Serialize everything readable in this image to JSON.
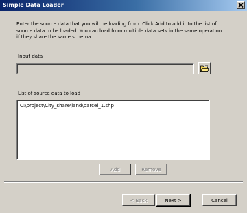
{
  "window": {
    "title": "Simple Data Loader",
    "close_icon": "close-icon"
  },
  "instructions": "Enter the source data that you will be loading from. Click Add to add it to the list of source data to be loaded. You can load from multiple data sets in the same operation if they share the same schema.",
  "input_data": {
    "label": "Input data",
    "value": "",
    "browse_icon": "open-folder-icon"
  },
  "source_list": {
    "label": "List of source data to load",
    "items": [
      "C:\\project\\City_share\\land\\parcel_1.shp"
    ]
  },
  "buttons": {
    "add": "Add",
    "remove": "Remove",
    "back": "< Back",
    "next": "Next >",
    "cancel": "Cancel"
  },
  "colors": {
    "dialog_bg": "#d4d0c8",
    "titlebar_start": "#0a246a",
    "titlebar_end": "#a6caf0"
  }
}
